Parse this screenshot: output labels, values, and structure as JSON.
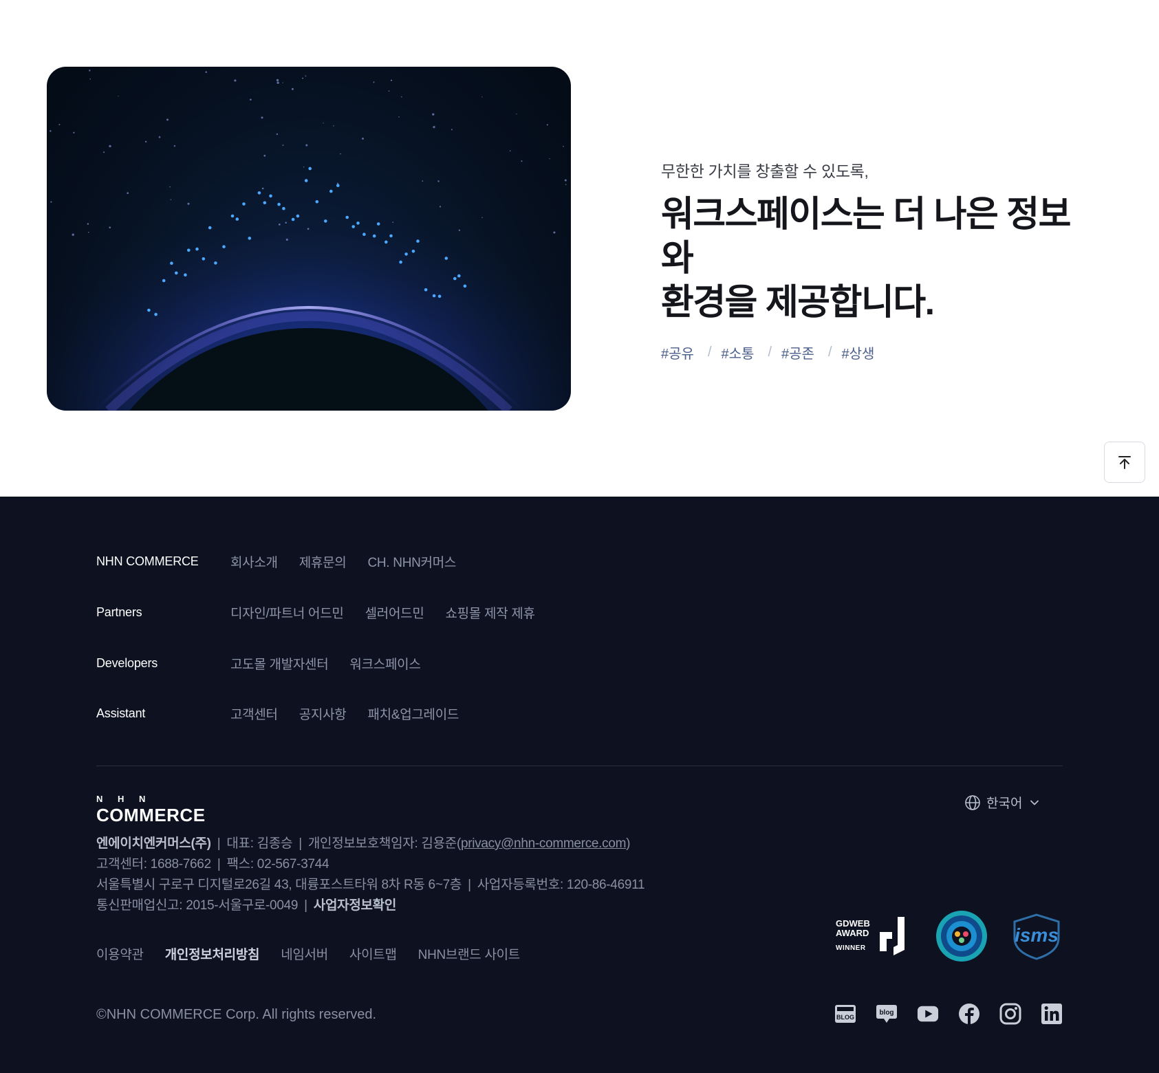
{
  "hero": {
    "subtitle": "무한한 가치를 창출할 수 있도록,",
    "title_line1": "워크스페이스는 더 나은 정보와",
    "title_line2": "환경을 제공합니다.",
    "tags": [
      "#공유",
      "#소통",
      "#공존",
      "#상생"
    ],
    "tag_separator": "/"
  },
  "footer": {
    "nav": [
      {
        "heading": "NHN COMMERCE",
        "links": [
          "회사소개",
          "제휴문의",
          "CH. NHN커머스"
        ]
      },
      {
        "heading": "Partners",
        "links": [
          "디자인/파트너 어드민",
          "셀러어드민",
          "쇼핑몰 제작 제휴"
        ]
      },
      {
        "heading": "Developers",
        "links": [
          "고도몰 개발자센터",
          "워크스페이스"
        ]
      },
      {
        "heading": "Assistant",
        "links": [
          "고객센터",
          "공지사항",
          "패치&업그레이드"
        ]
      }
    ],
    "logo": {
      "top": "N H N",
      "bottom": "COMMERCE"
    },
    "language": "한국어",
    "company": {
      "name": "엔에이치엔커머스(주)",
      "ceo": "대표: 김종승",
      "privacy_officer": "개인정보보호책임자: 김용준(",
      "privacy_email": "privacy@nhn-commerce.com",
      "privacy_close": ")",
      "customer_center": "고객센터: 1688-7662",
      "fax": "팩스: 02-567-3744",
      "address": "서울특별시 구로구 디지털로26길 43, 대륭포스트타워 8차 R동 6~7층",
      "biz_reg": "사업자등록번호: 120-86-46911",
      "ecommerce_reg": "통신판매업신고: 2015-서울구로-0049",
      "biz_check": "사업자정보확인"
    },
    "policies": [
      "이용약관",
      "개인정보처리방침",
      "네임서버",
      "사이트맵",
      "NHN브랜드 사이트"
    ],
    "copyright": "©NHN COMMERCE Corp. All rights reserved.",
    "awards": {
      "gdweb_line1": "GDWEB",
      "gdweb_line2": "AWARD",
      "gdweb_line3": "WINNER",
      "isms": "isms"
    },
    "social_icons": [
      "blog-icon",
      "naver-blog-icon",
      "youtube-icon",
      "facebook-icon",
      "instagram-icon",
      "linkedin-icon"
    ]
  },
  "colors": {
    "footer_bg": "#0d1120",
    "accent_tag": "#4a5f8c",
    "hero_title": "#14161c"
  }
}
